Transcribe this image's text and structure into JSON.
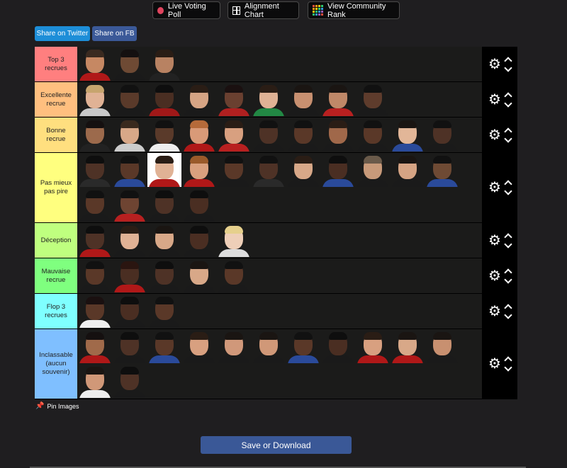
{
  "nav": {
    "live_label": "Live Voting Poll",
    "alignment_label": "Alignment Chart",
    "community_label": "View Community Rank"
  },
  "share": {
    "twitter_label": "Share on Twitter",
    "fb_label": "Share on FB"
  },
  "tiers": [
    {
      "label": "Top 3 recrues",
      "color": "#ff7f7f",
      "players": [
        {
          "s": "#c68863",
          "h": "#3a2a20",
          "j": "#b01818"
        },
        {
          "s": "#6e4a34",
          "h": "#141010",
          "j": "#1a1a1a"
        },
        {
          "s": "#b88262",
          "h": "#2a1d15",
          "j": "#222222"
        }
      ]
    },
    {
      "label": "Excellente recrue",
      "color": "#ffbf7f",
      "players": [
        {
          "s": "#e0b295",
          "h": "#c7a56e",
          "j": "#c8c8c8"
        },
        {
          "s": "#5a3a2a",
          "h": "#111111",
          "j": "#1a1a1a"
        },
        {
          "s": "#4a2e22",
          "h": "#0e0e0e",
          "j": "#a01818"
        },
        {
          "s": "#d6a484",
          "h": "#2a1d15",
          "j": "#1a1a1a"
        },
        {
          "s": "#6a4030",
          "h": "#1a1010",
          "j": "#b02020"
        },
        {
          "s": "#e0b295",
          "h": "#2a1d15",
          "j": "#228844"
        },
        {
          "s": "#c89070",
          "h": "#1a1512",
          "j": "#1a1a1a"
        },
        {
          "s": "#c08868",
          "h": "#1a1512",
          "j": "#b82020"
        },
        {
          "s": "#5e3c2c",
          "h": "#111111",
          "j": "#1a1a1a"
        }
      ]
    },
    {
      "label": "Bonne recrue",
      "color": "#ffdf7f",
      "players": [
        {
          "s": "#9c6a4c",
          "h": "#151010",
          "j": "#222222"
        },
        {
          "s": "#d8a888",
          "h": "#3a2a1e",
          "j": "#cccccc"
        },
        {
          "s": "#5a3a2a",
          "h": "#111111",
          "j": "#eeeeee"
        },
        {
          "s": "#d99a78",
          "h": "#b56a3a",
          "j": "#b01818"
        },
        {
          "s": "#d8a080",
          "h": "#2a1d15",
          "j": "#b82020"
        },
        {
          "s": "#4e3226",
          "h": "#111111",
          "j": "#1a1a1a"
        },
        {
          "s": "#5a3828",
          "h": "#111111",
          "j": "#1a1a1a"
        },
        {
          "s": "#a0684a",
          "h": "#2a1d15",
          "j": "#1a1a1a"
        },
        {
          "s": "#5a3828",
          "h": "#111111",
          "j": "#1a1a1a"
        },
        {
          "s": "#e2b698",
          "h": "#1a1512",
          "j": "#2a4a9a"
        },
        {
          "s": "#4e3226",
          "h": "#111111",
          "j": "#1a1a1a"
        }
      ]
    },
    {
      "label": "Pas mieux pas pire",
      "color": "#ffff7f",
      "players": [
        {
          "s": "#4e3226",
          "h": "#0e0e0e",
          "j": "#2a2a2a"
        },
        {
          "s": "#5a3828",
          "h": "#111111",
          "j": "#2a4a9a"
        },
        {
          "s": "#e0b295",
          "h": "#2a1d15",
          "j": "#b01818",
          "white": true
        },
        {
          "s": "#d9a07e",
          "h": "#9a5a2a",
          "j": "#b01818"
        },
        {
          "s": "#5a3828",
          "h": "#111111",
          "j": "#1a1a1a"
        },
        {
          "s": "#4e3226",
          "h": "#111111",
          "j": "#2a2a2a"
        },
        {
          "s": "#d8a888",
          "h": "#2a1d15",
          "j": "#1a1a1a"
        },
        {
          "s": "#4a2e22",
          "h": "#0e0e0e",
          "j": "#2a4a9a"
        },
        {
          "s": "#c89a7a",
          "h": "#6a5a4a",
          "j": "#1a1a1a"
        },
        {
          "s": "#d6a484",
          "h": "#1a1512",
          "j": "#1a1a1a"
        },
        {
          "s": "#6e4a34",
          "h": "#111111",
          "j": "#2a4a9a"
        },
        {
          "s": "#5a3828",
          "h": "#111111",
          "j": "#1a1a1a"
        },
        {
          "s": "#6e4432",
          "h": "#111111",
          "j": "#b82020"
        },
        {
          "s": "#4e3226",
          "h": "#0e0e0e",
          "j": "#1a1a1a"
        },
        {
          "s": "#4a2e22",
          "h": "#0e0e0e",
          "j": "#1a1a1a"
        }
      ]
    },
    {
      "label": "Déception",
      "color": "#bfff7f",
      "players": [
        {
          "s": "#4e3226",
          "h": "#0e0e0e",
          "j": "#b01818"
        },
        {
          "s": "#e0b295",
          "h": "#2a1d15",
          "j": "#1a1a1a"
        },
        {
          "s": "#d8a888",
          "h": "#1a1512",
          "j": "#1a1a1a"
        },
        {
          "s": "#4a2e22",
          "h": "#0e0e0e",
          "j": "#1a1a1a"
        },
        {
          "s": "#eecfb8",
          "h": "#e6d08c",
          "j": "#dddddd"
        }
      ]
    },
    {
      "label": "Mauvaise recrue",
      "color": "#7fff7f",
      "players": [
        {
          "s": "#5a3828",
          "h": "#111111",
          "j": "#1a1a1a"
        },
        {
          "s": "#4a2e22",
          "h": "#2a1510",
          "j": "#b01818"
        },
        {
          "s": "#4e3226",
          "h": "#0e0e0e",
          "j": "#1a1a1a"
        },
        {
          "s": "#d8a888",
          "h": "#1a1512",
          "j": "#1a1a1a"
        },
        {
          "s": "#5a3828",
          "h": "#111111",
          "j": "#1a1a1a"
        }
      ]
    },
    {
      "label": "Flop 3 recrues",
      "color": "#7fffff",
      "players": [
        {
          "s": "#5a3828",
          "h": "#1a1010",
          "j": "#eeeeee"
        },
        {
          "s": "#4a2e22",
          "h": "#0e0e0e",
          "j": "#1a1a1a"
        },
        {
          "s": "#5a3828",
          "h": "#111111",
          "j": "#1a1a1a"
        }
      ]
    },
    {
      "label": "Inclassable (aucun souvenir)",
      "color": "#7fbfff",
      "players": [
        {
          "s": "#a06a4a",
          "h": "#151010",
          "j": "#b01818"
        },
        {
          "s": "#4e3226",
          "h": "#0e0e0e",
          "j": "#1a1a1a"
        },
        {
          "s": "#5a3828",
          "h": "#111111",
          "j": "#2a4a9a"
        },
        {
          "s": "#d8a080",
          "h": "#2a1d15",
          "j": "#1a1a1a"
        },
        {
          "s": "#d0987a",
          "h": "#1a1512",
          "j": "#1a1a1a"
        },
        {
          "s": "#d09878",
          "h": "#1a1512",
          "j": "#1a1a1a"
        },
        {
          "s": "#5a3828",
          "h": "#111111",
          "j": "#2a4a9a"
        },
        {
          "s": "#4a2e22",
          "h": "#0e0e0e",
          "j": "#1a1a1a"
        },
        {
          "s": "#d8a080",
          "h": "#2a1d15",
          "j": "#b01818"
        },
        {
          "s": "#d8a888",
          "h": "#1a1512",
          "j": "#b01818"
        },
        {
          "s": "#c89070",
          "h": "#1a1512",
          "j": "#1a1a1a"
        },
        {
          "s": "#d09878",
          "h": "#1a1512",
          "j": "#eeeeee"
        },
        {
          "s": "#4e3226",
          "h": "#0e0e0e",
          "j": "#1a1a1a"
        }
      ]
    }
  ],
  "pin": {
    "label": "Pin Images",
    "icon": "pin-icon"
  },
  "save": {
    "label": "Save or Download"
  },
  "colors": {
    "save": "#3a5897",
    "twitter": "#1d8ed8",
    "fb": "#3b5998",
    "background": "#1f1e20"
  }
}
